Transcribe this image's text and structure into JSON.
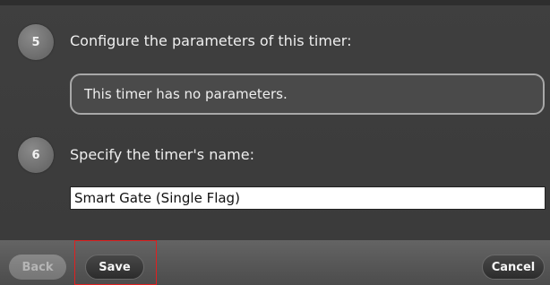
{
  "steps": [
    {
      "number": "5",
      "label": "Configure the parameters of this timer:"
    },
    {
      "number": "6",
      "label": "Specify the timer's name:"
    }
  ],
  "parameters_message": "This timer has no parameters.",
  "name_field": {
    "value": "Smart Gate (Single Flag)"
  },
  "buttons": {
    "back": "Back",
    "save": "Save",
    "cancel": "Cancel"
  },
  "colors": {
    "panel_bg": "#3c3c3c",
    "badge_bg": "#7a7a7a",
    "highlight": "#e02020"
  }
}
